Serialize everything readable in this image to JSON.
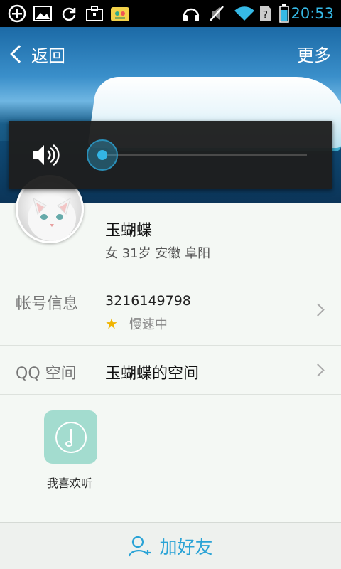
{
  "status_bar": {
    "time": "20:53",
    "icons": [
      "add-circle-icon",
      "image-icon",
      "sync-icon",
      "briefcase-icon",
      "qq-notification-icon",
      "headphones-icon",
      "mute-icon",
      "wifi-icon",
      "no-sim-icon",
      "battery-icon"
    ]
  },
  "header": {
    "back_label": "返回",
    "more_label": "更多"
  },
  "volume_overlay": {
    "icon": "speaker-icon",
    "level": 0.0
  },
  "profile": {
    "name": "玉蝴蝶",
    "info": "女 31岁 安徽 阜阳"
  },
  "account": {
    "label": "帐号信息",
    "number": "3216149798",
    "status": "慢速中"
  },
  "qzone": {
    "label": "QQ 空间",
    "space_name": "玉蝴蝶的空间"
  },
  "music": {
    "label": "我喜欢听"
  },
  "bottom": {
    "add_friend_label": "加好友"
  },
  "colors": {
    "accent": "#33b5e5",
    "time": "#36b9e6",
    "add_friend": "#2aa3d6",
    "music_tile": "#a3dccf"
  }
}
